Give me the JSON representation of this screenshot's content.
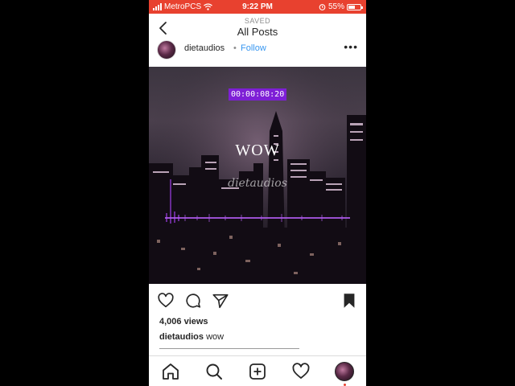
{
  "status_bar": {
    "carrier": "MetroPCS",
    "time": "9:22 PM",
    "battery_percent": "55%",
    "battery_level": 0.55,
    "background_color": "#e8412f"
  },
  "header": {
    "subtitle": "SAVED",
    "title": "All Posts"
  },
  "post": {
    "username": "dietaudios",
    "separator": "•",
    "follow_label": "Follow",
    "more_label": "•••",
    "timecode": "00:00:08:20",
    "overlay_title": "WOW",
    "overlay_watermark": "dietaudios",
    "views": "4,006 views",
    "caption_user": "dietaudios",
    "caption_text": "wow"
  },
  "icons": {
    "back": "chevron-left-icon",
    "like": "heart-icon",
    "comment": "comment-icon",
    "share": "paper-plane-icon",
    "save": "bookmark-filled-icon",
    "home": "home-icon",
    "search": "search-icon",
    "add": "plus-square-icon",
    "activity": "heart-icon",
    "profile": "profile-avatar"
  },
  "colors": {
    "link": "#3897f0",
    "accent_purple": "#7e1fd6"
  }
}
